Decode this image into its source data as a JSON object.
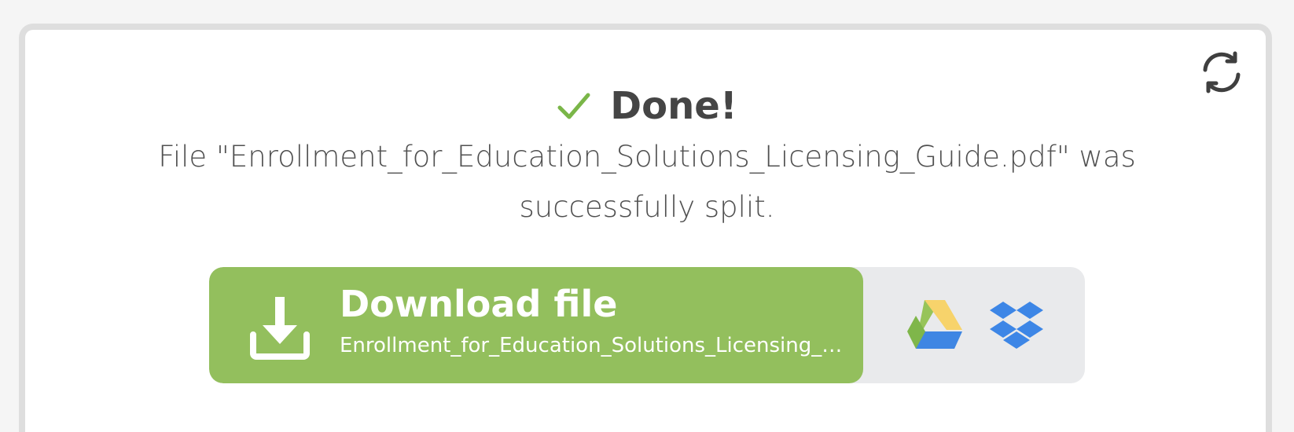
{
  "status": {
    "title": "Done!",
    "message": "File \"Enrollment_for_Education_Solutions_Licensing_Guide.pdf\" was successfully split."
  },
  "download": {
    "label": "Download file",
    "filename": "Enrollment_for_Education_Solutions_Licensing_Guide.pdf"
  },
  "icons": {
    "refresh": "refresh-icon",
    "check": "checkmark-icon",
    "download": "download-icon",
    "google_drive": "google-drive-icon",
    "dropbox": "dropbox-icon"
  },
  "colors": {
    "accent_green": "#93bf5d",
    "check_green": "#7ab648",
    "text_dark": "#454545",
    "cloud_panel": "#e9eaec",
    "dropbox_blue": "#3d86e6"
  }
}
